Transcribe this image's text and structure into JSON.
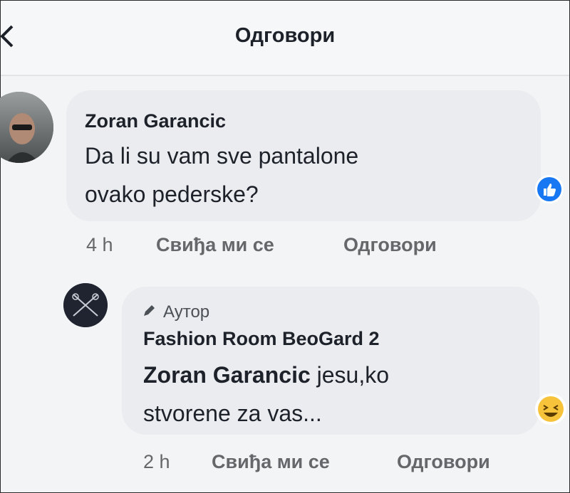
{
  "header": {
    "title": "Одговори"
  },
  "comments": [
    {
      "author": "Zoran Garancic",
      "text_line1": "Da li su vam sve pantalone",
      "text_line2": "ovako pederske?",
      "time": "4 h",
      "like_label": "Свиђа ми се",
      "reply_label": "Одговори",
      "reaction_icon": "like-icon"
    },
    {
      "author_badge": "Аутор",
      "author": "Fashion Room BeoGard 2",
      "mention": "Zoran Garancic",
      "text_line1_rest": " jesu,ko",
      "text_line2": "stvorene za vas...",
      "time": "2 h",
      "like_label": "Свиђа ми се",
      "reply_label": "Одговори",
      "reaction_icon": "haha-icon"
    }
  ],
  "colors": {
    "bubble": "#ebecef",
    "like_blue": "#1877f2",
    "haha_yellow": "#f7c33b"
  }
}
